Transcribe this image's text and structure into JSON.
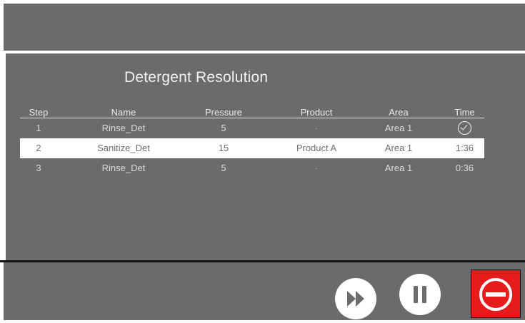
{
  "panel": {
    "title": "Detergent Resolution"
  },
  "table": {
    "headers": {
      "step": "Step",
      "name": "Name",
      "pressure": "Pressure",
      "product": "Product",
      "area": "Area",
      "time": "Time"
    },
    "rows": [
      {
        "step": "1",
        "name": "Rinse_Det",
        "pressure": "5",
        "product": "-",
        "area": "Area 1",
        "time": "",
        "status_icon": "check-circle-icon"
      },
      {
        "step": "2",
        "name": "Sanitize_Det",
        "pressure": "15",
        "product": "Product A",
        "area": "Area 1",
        "time": "1:36"
      },
      {
        "step": "3",
        "name": "Rinse_Det",
        "pressure": "5",
        "product": "-",
        "area": "Area 1",
        "time": "0:36"
      }
    ]
  },
  "controls": {
    "skip_icon": "fast-forward-icon",
    "pause_icon": "pause-icon",
    "stop_icon": "stop-icon"
  },
  "colors": {
    "panel_bg": "#6b6b6b",
    "stop_red": "#e81b1b",
    "selected_row_bg": "#ffffff"
  }
}
